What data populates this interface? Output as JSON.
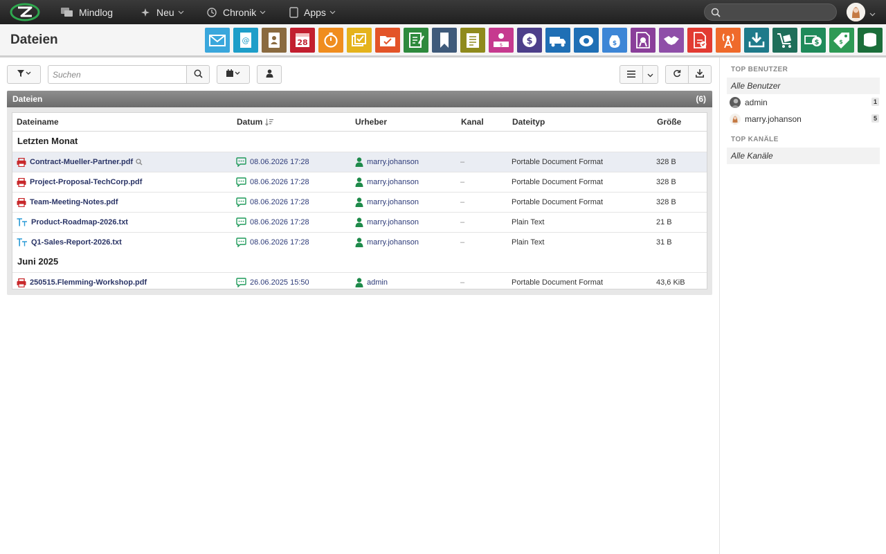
{
  "topbar": {
    "nav": [
      {
        "label": "Mindlog",
        "icon": "chat-icon"
      },
      {
        "label": "Neu",
        "icon": "sparkle-icon"
      },
      {
        "label": "Chronik",
        "icon": "history-icon"
      },
      {
        "label": "Apps",
        "icon": "tablet-icon"
      }
    ],
    "search_placeholder": ""
  },
  "header": {
    "title": "Dateien",
    "apps": [
      {
        "name": "mail-app-icon",
        "color": "#3aa7dc"
      },
      {
        "name": "addressbook-app-icon",
        "color": "#1e9ec9"
      },
      {
        "name": "contacts-app-icon",
        "color": "#8a6a3f"
      },
      {
        "name": "calendar-app-icon",
        "color": "#c21f2f"
      },
      {
        "name": "timer-app-icon",
        "color": "#f08d1e"
      },
      {
        "name": "tasks-app-icon",
        "color": "#e5b31c"
      },
      {
        "name": "projects-app-icon",
        "color": "#e35428"
      },
      {
        "name": "notes-app-icon",
        "color": "#2e8a3d"
      },
      {
        "name": "bookmark-app-icon",
        "color": "#3f5a7a"
      },
      {
        "name": "documents-app-icon",
        "color": "#8f8a1c"
      },
      {
        "name": "cashdesk-app-icon",
        "color": "#c63a8f"
      },
      {
        "name": "finance-app-icon",
        "color": "#4d3f8a"
      },
      {
        "name": "delivery-app-icon",
        "color": "#1f6fb5"
      },
      {
        "name": "piggybank-app-icon",
        "color": "#1f6fb5"
      },
      {
        "name": "moneybag-app-icon",
        "color": "#3d86d6"
      },
      {
        "name": "license-app-icon",
        "color": "#8a3f9a"
      },
      {
        "name": "handshake-app-icon",
        "color": "#8f4fa8"
      },
      {
        "name": "pdf-app-icon",
        "color": "#e23b32"
      },
      {
        "name": "broadcast-app-icon",
        "color": "#ef6a2b"
      },
      {
        "name": "download-app-icon",
        "color": "#1f7a8a"
      },
      {
        "name": "cart-app-icon",
        "color": "#1f6e5a"
      },
      {
        "name": "cash-app-icon",
        "color": "#1f8a5a"
      },
      {
        "name": "pricetag-app-icon",
        "color": "#2e9a55"
      },
      {
        "name": "database-app-icon",
        "color": "#1b6e3a"
      }
    ]
  },
  "toolbar": {
    "search_placeholder": "Suchen"
  },
  "panel": {
    "title": "Dateien",
    "count": "(6)",
    "columns": {
      "name": "Dateiname",
      "date": "Datum",
      "author": "Urheber",
      "channel": "Kanal",
      "type": "Dateityp",
      "size": "Größe"
    },
    "groups": [
      {
        "label": "Letzten Monat",
        "rows": [
          {
            "name": "Contract-Mueller-Partner.pdf",
            "kind": "pdf",
            "date": "08.06.2026 17:28",
            "author": "marry.johanson",
            "channel": "–",
            "type": "Portable Document Format",
            "size": "328 B"
          },
          {
            "name": "Project-Proposal-TechCorp.pdf",
            "kind": "pdf",
            "date": "08.06.2026 17:28",
            "author": "marry.johanson",
            "channel": "–",
            "type": "Portable Document Format",
            "size": "328 B"
          },
          {
            "name": "Team-Meeting-Notes.pdf",
            "kind": "pdf",
            "date": "08.06.2026 17:28",
            "author": "marry.johanson",
            "channel": "–",
            "type": "Portable Document Format",
            "size": "328 B"
          },
          {
            "name": "Product-Roadmap-2026.txt",
            "kind": "txt",
            "date": "08.06.2026 17:28",
            "author": "marry.johanson",
            "channel": "–",
            "type": "Plain Text",
            "size": "21 B"
          },
          {
            "name": "Q1-Sales-Report-2026.txt",
            "kind": "txt",
            "date": "08.06.2026 17:28",
            "author": "marry.johanson",
            "channel": "–",
            "type": "Plain Text",
            "size": "31 B"
          }
        ]
      },
      {
        "label": "Juni 2025",
        "rows": [
          {
            "name": "250515.Flemming-Workshop.pdf",
            "kind": "pdf",
            "date": "26.06.2025 15:50",
            "author": "admin",
            "channel": "–",
            "type": "Portable Document Format",
            "size": "43,6 KiB"
          }
        ]
      }
    ]
  },
  "sidebar": {
    "top_users_heading": "TOP BENUTZER",
    "all_users": "Alle Benutzer",
    "users": [
      {
        "name": "admin",
        "count": "1"
      },
      {
        "name": "marry.johanson",
        "count": "5"
      }
    ],
    "top_channels_heading": "TOP KANÄLE",
    "all_channels": "Alle Kanäle"
  }
}
